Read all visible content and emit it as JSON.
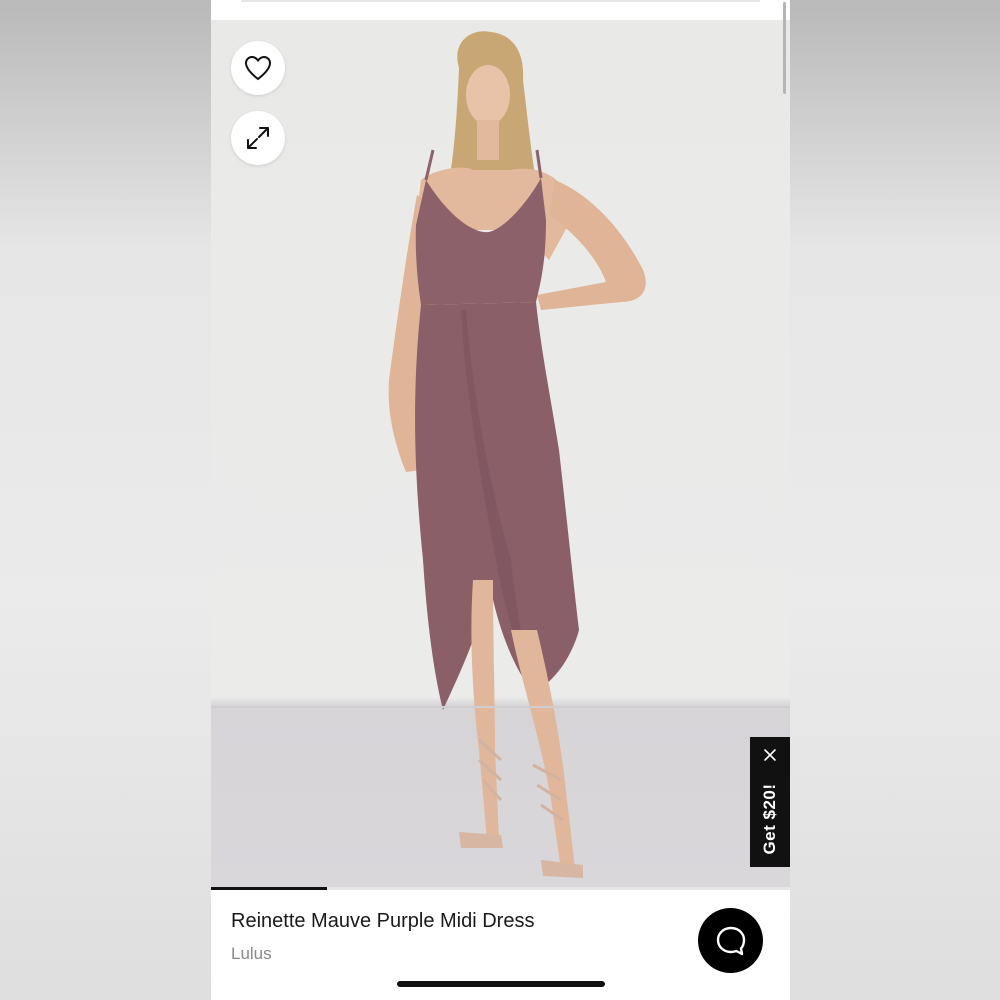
{
  "product": {
    "title": "Reinette Mauve Purple Midi Dress",
    "brand": "Lulus"
  },
  "gallery": {
    "favorite_icon": "heart-outline-icon",
    "expand_icon": "expand-arrows-icon",
    "progress_fraction": 0.2,
    "dress_color": "#8a5f68"
  },
  "promo": {
    "label": "Get $20!",
    "close_icon": "close-icon"
  },
  "chat": {
    "icon": "chat-bubble-icon"
  },
  "colors": {
    "accent": "#111111",
    "background": "#ffffff",
    "muted_text": "#8a8a8a"
  }
}
